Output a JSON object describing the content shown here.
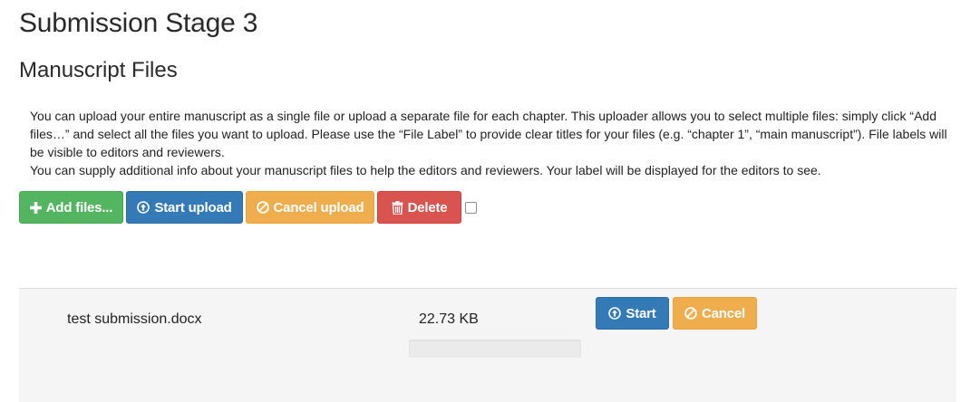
{
  "page": {
    "title": "Submission Stage 3",
    "section_title": "Manuscript Files",
    "instructions": [
      "You can upload your entire manuscript as a single file or upload a separate file for each chapter. This uploader allows you to select multiple files: simply click “Add files…” and select all the files you want to upload. Please use the “File Label” to provide clear titles for your files (e.g. “chapter 1”, “main manuscript”). File labels will be visible to editors and reviewers.",
      "You can supply additional info about your manuscript files to help the editors and reviewers. Your label will be displayed for the editors to see."
    ]
  },
  "toolbar": {
    "add_files_label": "Add files...",
    "start_upload_label": "Start upload",
    "cancel_upload_label": "Cancel upload",
    "delete_label": "Delete",
    "select_all_checked": false
  },
  "files": [
    {
      "name": "test submission.docx",
      "size": "22.73 KB",
      "progress": 0,
      "start_label": "Start",
      "cancel_label": "Cancel"
    }
  ],
  "colors": {
    "success": "#53b560",
    "primary": "#337ab7",
    "warning": "#f0ad4e",
    "danger": "#d9534f",
    "row_background": "#f5f5f5"
  },
  "icons": {
    "add_files": "plus-icon",
    "start_upload": "circle-arrow-up-icon",
    "cancel_upload": "ban-circle-icon",
    "delete": "trash-icon",
    "start": "circle-arrow-up-icon",
    "cancel": "ban-circle-icon"
  }
}
